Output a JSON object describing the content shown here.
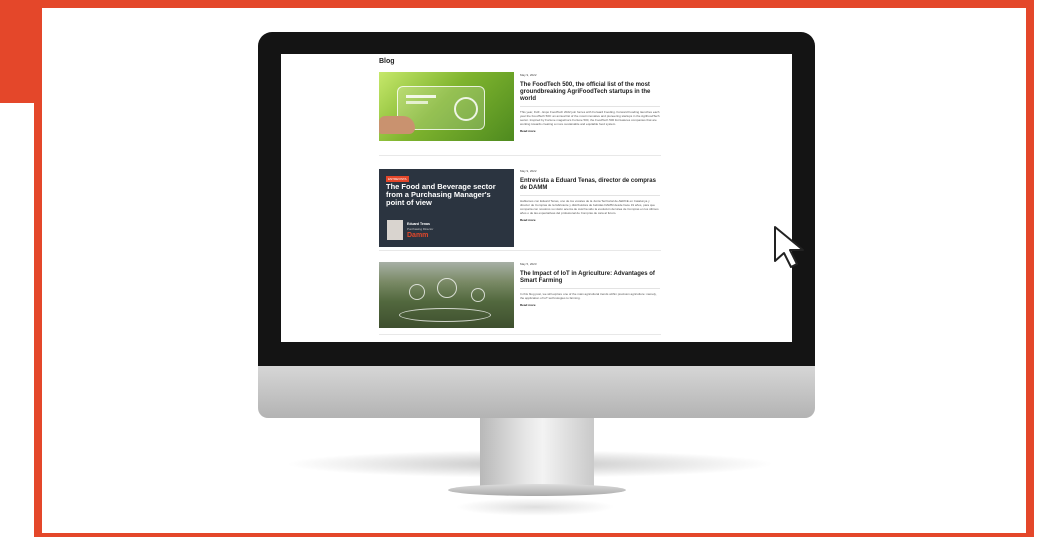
{
  "colors": {
    "accent": "#e4472a",
    "bezel": "#141414",
    "stand": "#c8c8c8"
  },
  "blog": {
    "title": "Blog",
    "posts": [
      {
        "date": "May 9, 2022",
        "heading": "The FoodTech 500, the official list of the most groundbreaking AgriFoodTech startups in the world",
        "excerpt": "This year, FHF - Expo FoodTech 2022 join forces with Forward Fooding. Forward Fooding launches each year the FoodTech 500: an annual list of the most innovative and pioneering startups in the AgriFoodTech sector. Inspired by Fortune magazine's Fortune 500, the FoodTech 500 list features companies that are working towards creating a more sustainable and equitable food system.",
        "read_more": "Read more"
      },
      {
        "date": "May 9, 2022",
        "heading": "Entrevista a Eduard Tenas, director de compras de DAMM",
        "excerpt": "Hablamos con Eduard Tenas, uno de los vocales de la Junta Territorial de AERCE en Catalunya y director de Compras de la fabricante y distribuidora de bebidas DAMM desde hace 19 años, para que comparta con nosotros su visión acerca de cuál ha sido la evolución del área de Compras en los últimos años o de las expectativas del profesional de Compras de cara al futuro.",
        "read_more": "Read more",
        "image": {
          "tag": "ENTREVISTA",
          "headline": "The Food and Beverage sector from a Purchasing Manager's point of view",
          "person_name": "Eduard Tenas",
          "person_role": "Purchasing Director",
          "brand": "Damm"
        }
      },
      {
        "date": "May 5, 2023",
        "heading": "The Impact of IoT in Agriculture: Advantages of Smart Farming",
        "excerpt": "In this blog post, we will explore one of the main agricultural trends within precision agriculture: namely, the application of IoT technologies to farming.",
        "read_more": "Read more"
      }
    ]
  }
}
